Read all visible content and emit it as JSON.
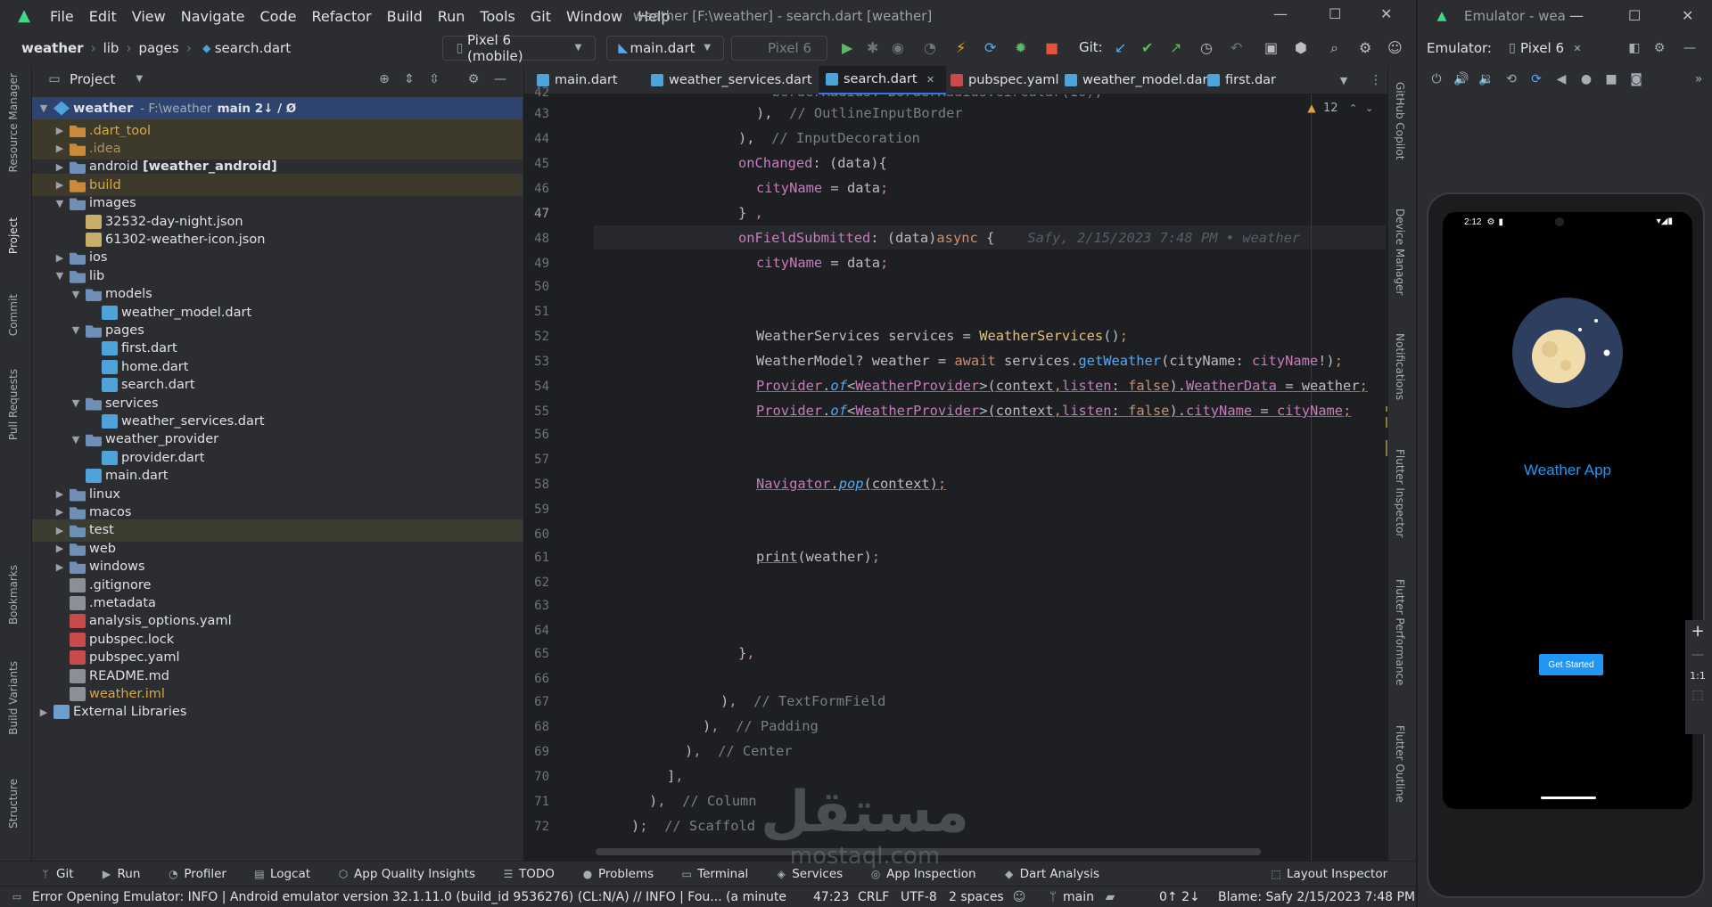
{
  "titlebar": {
    "menu": [
      "File",
      "Edit",
      "View",
      "Navigate",
      "Code",
      "Refactor",
      "Build",
      "Run",
      "Tools",
      "Git",
      "Window",
      "Help"
    ],
    "window_title": "weather [F:\\weather] - search.dart [weather]"
  },
  "navbar": {
    "crumbs": [
      "weather",
      "lib",
      "pages",
      "search.dart"
    ],
    "device": "Pixel 6 (mobile)",
    "run_config": "main.dart",
    "target": "Pixel 6",
    "git_label": "Git:"
  },
  "left_tools": [
    "Resource Manager",
    "Project",
    "Commit",
    "Pull Requests",
    "Bookmarks",
    "Build Variants",
    "Structure"
  ],
  "project": {
    "title": "Project",
    "root_name": "weather",
    "root_path": "- F:\\weather",
    "root_branch": "main 2↓ / Ø",
    "items": [
      {
        "label": ".dart_tool",
        "depth": 1,
        "kind": "folder",
        "open": false,
        "style": "excl"
      },
      {
        "label": ".idea",
        "depth": 1,
        "kind": "folder",
        "open": false,
        "style": "excl2"
      },
      {
        "label": "android",
        "extra": "[weather_android]",
        "depth": 1,
        "kind": "folder",
        "open": false
      },
      {
        "label": "build",
        "depth": 1,
        "kind": "folder",
        "open": false,
        "style": "excl"
      },
      {
        "label": "images",
        "depth": 1,
        "kind": "folder",
        "open": true
      },
      {
        "label": "32532-day-night.json",
        "depth": 2,
        "kind": "json"
      },
      {
        "label": "61302-weather-icon.json",
        "depth": 2,
        "kind": "json"
      },
      {
        "label": "ios",
        "depth": 1,
        "kind": "folder",
        "open": false
      },
      {
        "label": "lib",
        "depth": 1,
        "kind": "folder",
        "open": true
      },
      {
        "label": "models",
        "depth": 2,
        "kind": "folder",
        "open": true
      },
      {
        "label": "weather_model.dart",
        "depth": 3,
        "kind": "dart"
      },
      {
        "label": "pages",
        "depth": 2,
        "kind": "folder",
        "open": true
      },
      {
        "label": "first.dart",
        "depth": 3,
        "kind": "dart"
      },
      {
        "label": "home.dart",
        "depth": 3,
        "kind": "dart"
      },
      {
        "label": "search.dart",
        "depth": 3,
        "kind": "dart"
      },
      {
        "label": "services",
        "depth": 2,
        "kind": "folder",
        "open": true
      },
      {
        "label": "weather_services.dart",
        "depth": 3,
        "kind": "dart"
      },
      {
        "label": "weather_provider",
        "depth": 2,
        "kind": "folder",
        "open": true
      },
      {
        "label": "provider.dart",
        "depth": 3,
        "kind": "dart"
      },
      {
        "label": "main.dart",
        "depth": 2,
        "kind": "dart"
      },
      {
        "label": "linux",
        "depth": 1,
        "kind": "folder",
        "open": false
      },
      {
        "label": "macos",
        "depth": 1,
        "kind": "folder",
        "open": false
      },
      {
        "label": "test",
        "depth": 1,
        "kind": "folder",
        "open": false,
        "style": "lime"
      },
      {
        "label": "web",
        "depth": 1,
        "kind": "folder",
        "open": false
      },
      {
        "label": "windows",
        "depth": 1,
        "kind": "folder",
        "open": false
      },
      {
        "label": ".gitignore",
        "depth": 1,
        "kind": "txt"
      },
      {
        "label": ".metadata",
        "depth": 1,
        "kind": "txt"
      },
      {
        "label": "analysis_options.yaml",
        "depth": 1,
        "kind": "yaml"
      },
      {
        "label": "pubspec.lock",
        "depth": 1,
        "kind": "yaml"
      },
      {
        "label": "pubspec.yaml",
        "depth": 1,
        "kind": "yaml"
      },
      {
        "label": "README.md",
        "depth": 1,
        "kind": "txt"
      },
      {
        "label": "weather.iml",
        "depth": 1,
        "kind": "txt",
        "style": "iml"
      },
      {
        "label": "External Libraries",
        "depth": 0,
        "kind": "lib",
        "open": false
      }
    ]
  },
  "tabs": [
    "main.dart",
    "weather_services.dart",
    "search.dart",
    "pubspec.yaml",
    "weather_model.dart",
    "first.dar"
  ],
  "active_tab": "search.dart",
  "editor": {
    "warnings": "12",
    "line_numbers": [
      "42",
      "43",
      "44",
      "45",
      "46",
      "47",
      "48",
      "49",
      "50",
      "51",
      "52",
      "53",
      "54",
      "55",
      "56",
      "57",
      "58",
      "59",
      "60",
      "61",
      "62",
      "63",
      "64",
      "65",
      "66",
      "67",
      "68",
      "69",
      "70",
      "71",
      "72"
    ],
    "current_line": "47",
    "blame": "Safy, 2/15/2023 7:48 PM • weather"
  },
  "right_tools": [
    "GitHub Copilot",
    "Device Manager",
    "Notifications",
    "Flutter Inspector",
    "Flutter Performance",
    "Flutter Outline"
  ],
  "bottom_tools": [
    "Git",
    "Run",
    "Profiler",
    "Logcat",
    "App Quality Insights",
    "TODO",
    "Problems",
    "Terminal",
    "Services",
    "App Inspection",
    "Dart Analysis",
    "Layout Inspector"
  ],
  "status": {
    "message": "Error Opening Emulator: INFO    | Android emulator version 32.1.11.0 (build_id 9536276) (CL:N/A) // INFO    | Fou... (a minute ag",
    "position": "47:23",
    "line_sep": "CRLF",
    "encoding": "UTF-8",
    "indent": "2 spaces",
    "branch": "main",
    "git_counts": "0↑ 2↓",
    "blame": "Blame: Safy 2/15/2023 7:48 PM"
  },
  "emulator": {
    "window_title": "Emulator - wea",
    "label": "Emulator:",
    "device": "Pixel 6",
    "phone_time": "2:12",
    "app_title": "Weather App",
    "button_label": "Get Started",
    "zoom_ratio": "1:1"
  },
  "watermark": {
    "arabic": "مستقل",
    "latin": "mostaql.com"
  },
  "colors": {
    "accent": "#3574f0",
    "app_blue": "#2196f3",
    "moon_bg": "#2e3e5e",
    "moon": "#f0dcaa"
  }
}
